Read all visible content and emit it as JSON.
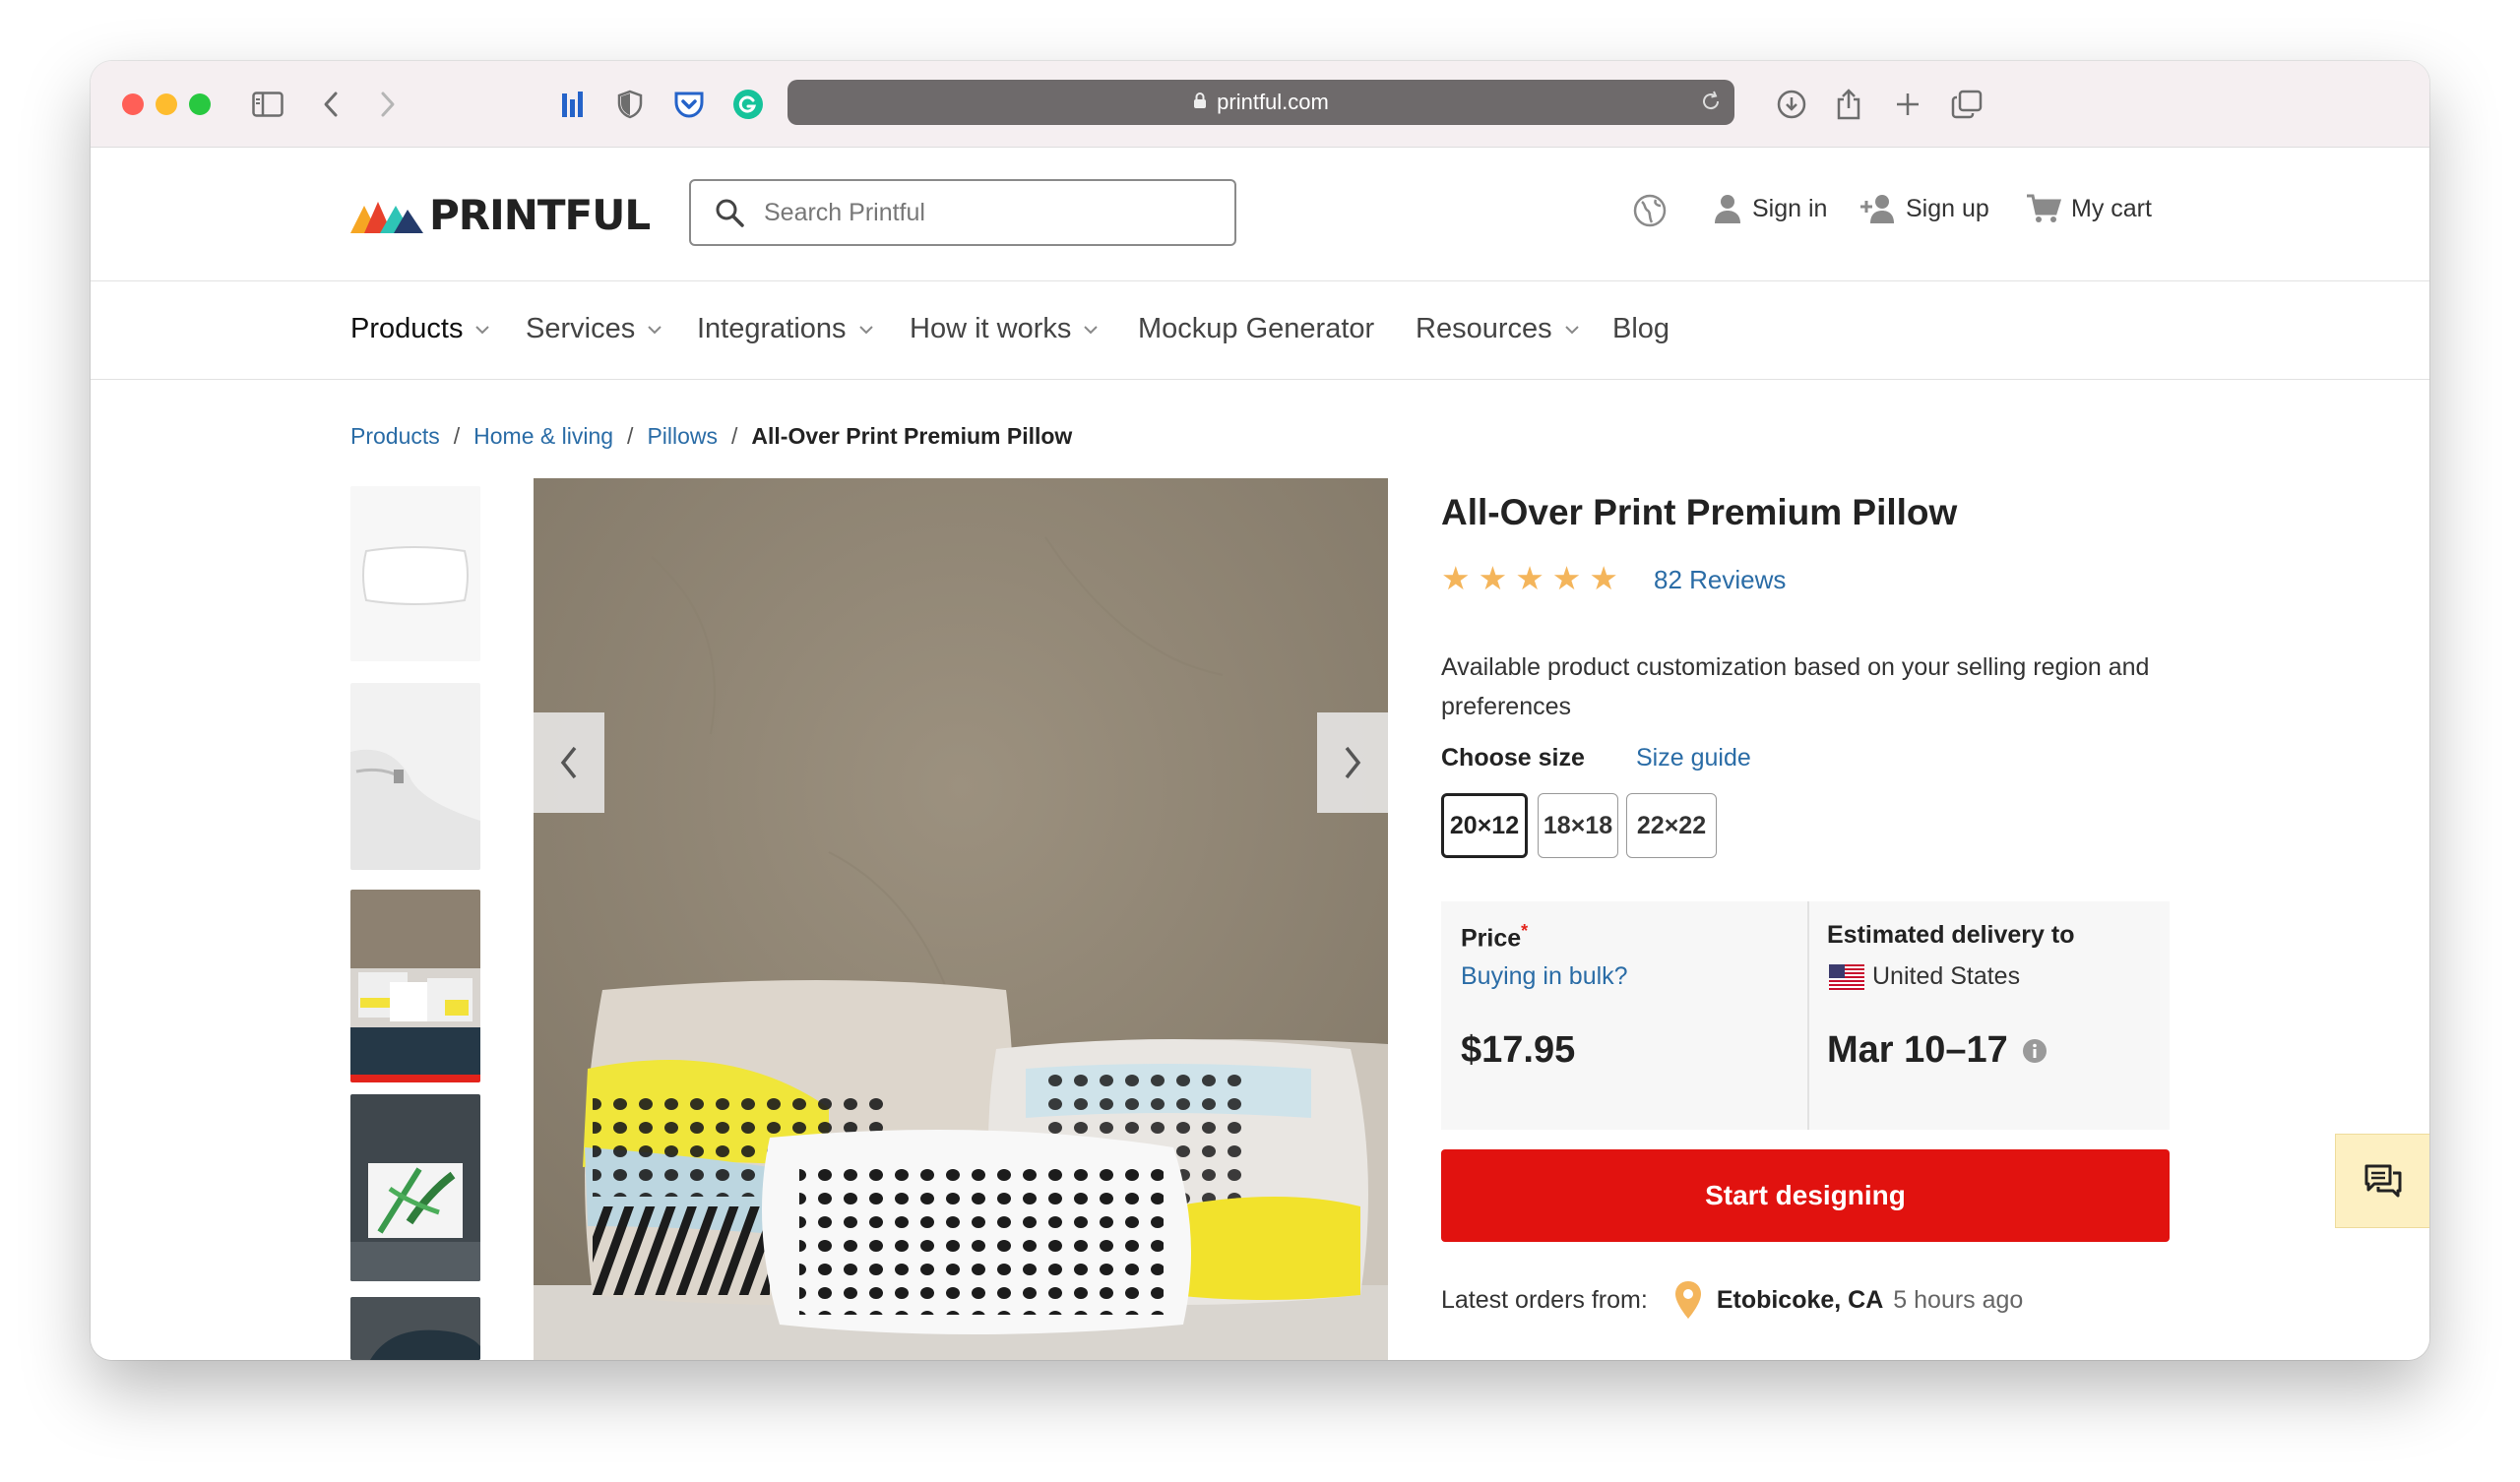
{
  "browser": {
    "url": "printful.com"
  },
  "header": {
    "logo_text": "PRINTFUL",
    "search_placeholder": "Search Printful",
    "sign_in": "Sign in",
    "sign_up": "Sign up",
    "cart": "My cart"
  },
  "nav": {
    "items": [
      {
        "label": "Products"
      },
      {
        "label": "Services"
      },
      {
        "label": "Integrations"
      },
      {
        "label": "How it works"
      },
      {
        "label": "Mockup Generator"
      },
      {
        "label": "Resources"
      },
      {
        "label": "Blog"
      }
    ]
  },
  "breadcrumb": {
    "items": [
      "Products",
      "Home & living",
      "Pillows"
    ],
    "current": "All-Over Print Premium Pillow",
    "separator": "/"
  },
  "product": {
    "title": "All-Over Print Premium Pillow",
    "rating": 5,
    "reviews": "82 Reviews",
    "description": "Available product customization based on your selling region and preferences",
    "choose_size_label": "Choose size",
    "size_guide": "Size guide",
    "sizes": [
      "20×12",
      "18×18",
      "22×22"
    ],
    "selected_size": "20×12"
  },
  "pricing": {
    "price_label": "Price",
    "required_mark": "*",
    "bulk_link": "Buying in bulk?",
    "price": "$17.95",
    "delivery_label": "Estimated delivery to",
    "country": "United States",
    "delivery_dates": "Mar 10–17"
  },
  "cta": {
    "label": "Start designing"
  },
  "latest_orders": {
    "label": "Latest orders from:",
    "location": "Etobicoke, CA",
    "time_ago": "5 hours ago"
  },
  "colors": {
    "accent_red": "#e1120f",
    "link_blue": "#2a6ca6",
    "star": "#f4b55b"
  }
}
